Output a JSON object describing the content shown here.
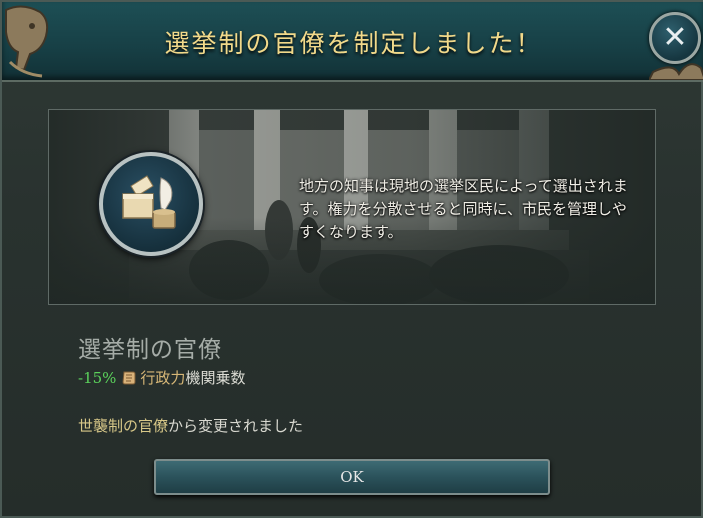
{
  "dialog": {
    "title": "選挙制の官僚を制定しました！",
    "close_label": "✕"
  },
  "scene": {
    "description": "地方の知事は現地の選挙区民によって選出されます。権力を分散させると同時に、市民を管理しやすくなります。",
    "icon": "ballot-box-quill-icon"
  },
  "policy": {
    "name": "選挙制の官僚",
    "modifier": {
      "value": "-15%",
      "icon": "scroll-icon",
      "keyword": "行政力",
      "rest": "機関乗数"
    },
    "change_key": "世襲制の官僚",
    "change_rest": "から変更されました"
  },
  "buttons": {
    "ok_label": "OK"
  },
  "colors": {
    "title_gold": "#f1d98a",
    "positive_green": "#5bd15b",
    "keyword_gold": "#d7b777",
    "titlebar_teal": "#173f45"
  }
}
